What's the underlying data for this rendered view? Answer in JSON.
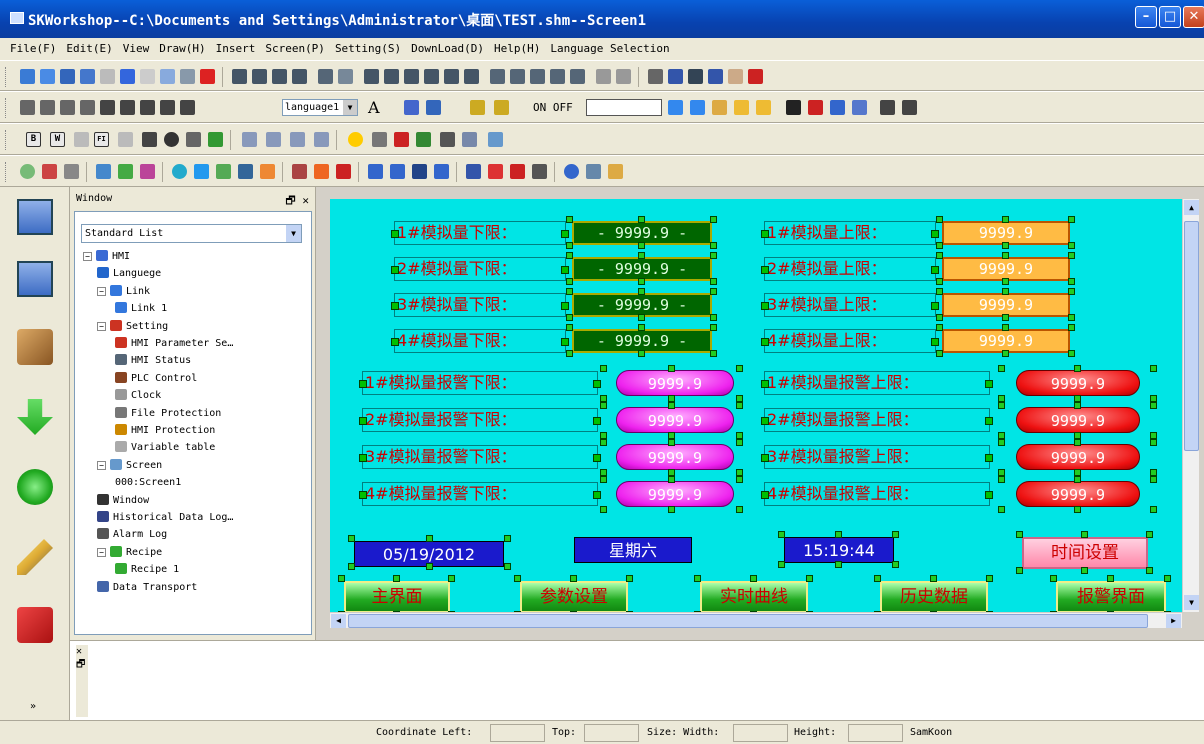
{
  "window": {
    "title": "SKWorkshop--C:\\Documents and Settings\\Administrator\\桌面\\TEST.shm--Screen1"
  },
  "menu": [
    "File(F)",
    "Edit(E)",
    "View",
    "Draw(H)",
    "Insert",
    "Screen(P)",
    "Setting(S)",
    "DownLoad(D)",
    "Help(H)",
    "Language Selection"
  ],
  "toolbar2": {
    "language_select": "language1",
    "font_button": "A",
    "on_label": "ON",
    "off_label": "OFF"
  },
  "toolbar3": {
    "b_label": "B",
    "w_label": "W",
    "fi_label": "FI"
  },
  "side_panel": {
    "header": "Window",
    "dropdown": "Standard List",
    "tree": [
      {
        "label": "HMI",
        "indent": 0,
        "pm": "−",
        "icon": "hmi-icon",
        "color": "#3a6ad4"
      },
      {
        "label": "Languege",
        "indent": 1,
        "pm": "",
        "icon": "globe-icon",
        "color": "#2266cc"
      },
      {
        "label": "Link",
        "indent": 1,
        "pm": "−",
        "icon": "link-icon",
        "color": "#3377dd"
      },
      {
        "label": "Link 1",
        "indent": 2,
        "pm": "",
        "icon": "link-icon",
        "color": "#3377dd"
      },
      {
        "label": "Setting",
        "indent": 1,
        "pm": "−",
        "icon": "tools-icon",
        "color": "#cc3322"
      },
      {
        "label": "HMI Parameter Se…",
        "indent": 2,
        "pm": "",
        "icon": "tools-icon",
        "color": "#cc3322"
      },
      {
        "label": "HMI Status",
        "indent": 2,
        "pm": "",
        "icon": "status-icon",
        "color": "#556677"
      },
      {
        "label": "PLC Control",
        "indent": 2,
        "pm": "",
        "icon": "plc-icon",
        "color": "#884422"
      },
      {
        "label": "Clock",
        "indent": 2,
        "pm": "",
        "icon": "clock-icon",
        "color": "#999999"
      },
      {
        "label": "File Protection",
        "indent": 2,
        "pm": "",
        "icon": "lock-icon",
        "color": "#777777"
      },
      {
        "label": "HMI Protection",
        "indent": 2,
        "pm": "",
        "icon": "key-icon",
        "color": "#cc8800"
      },
      {
        "label": "Variable table",
        "indent": 2,
        "pm": "",
        "icon": "table-icon",
        "color": "#aaaaaa"
      },
      {
        "label": "Screen",
        "indent": 1,
        "pm": "−",
        "icon": "screen-icon",
        "color": "#6699cc"
      },
      {
        "label": "000:Screen1",
        "indent": 2,
        "pm": "",
        "icon": "",
        "color": ""
      },
      {
        "label": "Window",
        "indent": 1,
        "pm": "",
        "icon": "window-icon",
        "color": "#333333"
      },
      {
        "label": "Historical Data Log…",
        "indent": 1,
        "pm": "",
        "icon": "save-icon",
        "color": "#334488"
      },
      {
        "label": "Alarm Log",
        "indent": 1,
        "pm": "",
        "icon": "alarm-icon",
        "color": "#555555"
      },
      {
        "label": "Recipe",
        "indent": 1,
        "pm": "−",
        "icon": "recipe-icon",
        "color": "#33aa33"
      },
      {
        "label": "Recipe 1",
        "indent": 2,
        "pm": "",
        "icon": "recipe-icon",
        "color": "#33aa33"
      },
      {
        "label": "Data Transport",
        "indent": 1,
        "pm": "",
        "icon": "transport-icon",
        "color": "#4466aa"
      }
    ]
  },
  "screen": {
    "lower_limit_labels": [
      "1#模拟量下限：",
      "2#模拟量下限：",
      "3#模拟量下限：",
      "4#模拟量下限："
    ],
    "lower_limit_values": [
      "- 9999.9 -",
      "- 9999.9 -",
      "- 9999.9 -",
      "- 9999.9 -"
    ],
    "upper_limit_labels": [
      "1#模拟量上限：",
      "2#模拟量上限：",
      "3#模拟量上限：",
      "4#模拟量上限："
    ],
    "upper_limit_values": [
      "9999.9",
      "9999.9",
      "9999.9",
      "9999.9"
    ],
    "alarm_low_labels": [
      "1#模拟量报警下限：",
      "2#模拟量报警下限：",
      "3#模拟量报警下限：",
      "4#模拟量报警下限："
    ],
    "alarm_low_values": [
      "9999.9",
      "9999.9",
      "9999.9",
      "9999.9"
    ],
    "alarm_high_labels": [
      "1#模拟量报警上限：",
      "2#模拟量报警上限：",
      "3#模拟量报警上限：",
      "4#模拟量报警上限："
    ],
    "alarm_high_values": [
      "9999.9",
      "9999.9",
      "9999.9",
      "9999.9"
    ],
    "date": "05/19/2012",
    "weekday": "星期六",
    "time": "15:19:44",
    "time_setting_button": "时间设置",
    "nav_buttons": [
      "主界面",
      "参数设置",
      "实时曲线",
      "历史数据",
      "报警界面"
    ]
  },
  "status_bar": {
    "coord_left": "Coordinate Left:",
    "top": "Top:",
    "size_width": "Size: Width:",
    "height": "Height:",
    "brand": "SamKoon"
  },
  "colors": {
    "canvas_bg": "#00e5e5",
    "label_red": "#cc0000",
    "titlebar_blue": "#0842b0"
  }
}
